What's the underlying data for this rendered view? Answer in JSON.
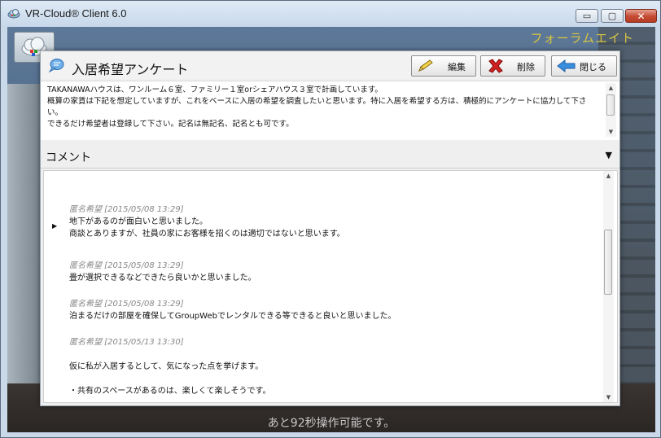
{
  "window": {
    "title": "VR-Cloud® Client 6.0",
    "buttons": {
      "minimize": "▭",
      "maximize": "▢",
      "close": "✕"
    }
  },
  "scene": {
    "brand": "フォーラムエイト",
    "status": "あと92秒操作可能です。"
  },
  "dialog": {
    "title": "入居希望アンケート",
    "toolbar": {
      "edit": "編集",
      "delete": "削除",
      "close": "閉じる"
    },
    "description": "TAKANAWAハウスは、ワンルーム６室、ファミリー１室orシェアハウス３室で計画しています。\n概算の家賃は下記を想定していますが、これをベースに入居の希望を調査したいと思います。特に入居を希望する方は、積極的にアンケートに協力して下さい。\nできるだけ希望者は登録して下さい。記名は無記名、記名とも可です。",
    "comments_header": "コメント",
    "comments": [
      {
        "meta": "匿名希望 [2015/05/08 13:29]",
        "lines": [
          "地下があるのが面白いと思いました。",
          "商談とありますが、社員の家にお客様を招くのは適切ではないと思います。"
        ]
      },
      {
        "meta": "匿名希望 [2015/05/08 13:29]",
        "lines": [
          "畳が選択できるなどできたら良いかと思いました。"
        ]
      },
      {
        "meta": "匿名希望 [2015/05/08 13:29]",
        "lines": [
          "泊まるだけの部屋を確保してGroupWebでレンタルできる等できると良いと思いました。"
        ]
      },
      {
        "meta": "匿名希望 [2015/05/13 13:30]",
        "lines": [
          "",
          "仮に私が入居するとして、気になった点を挙げます。",
          "",
          "・共有のスペースがあるのは、楽しくて楽しそうです。"
        ]
      }
    ]
  }
}
